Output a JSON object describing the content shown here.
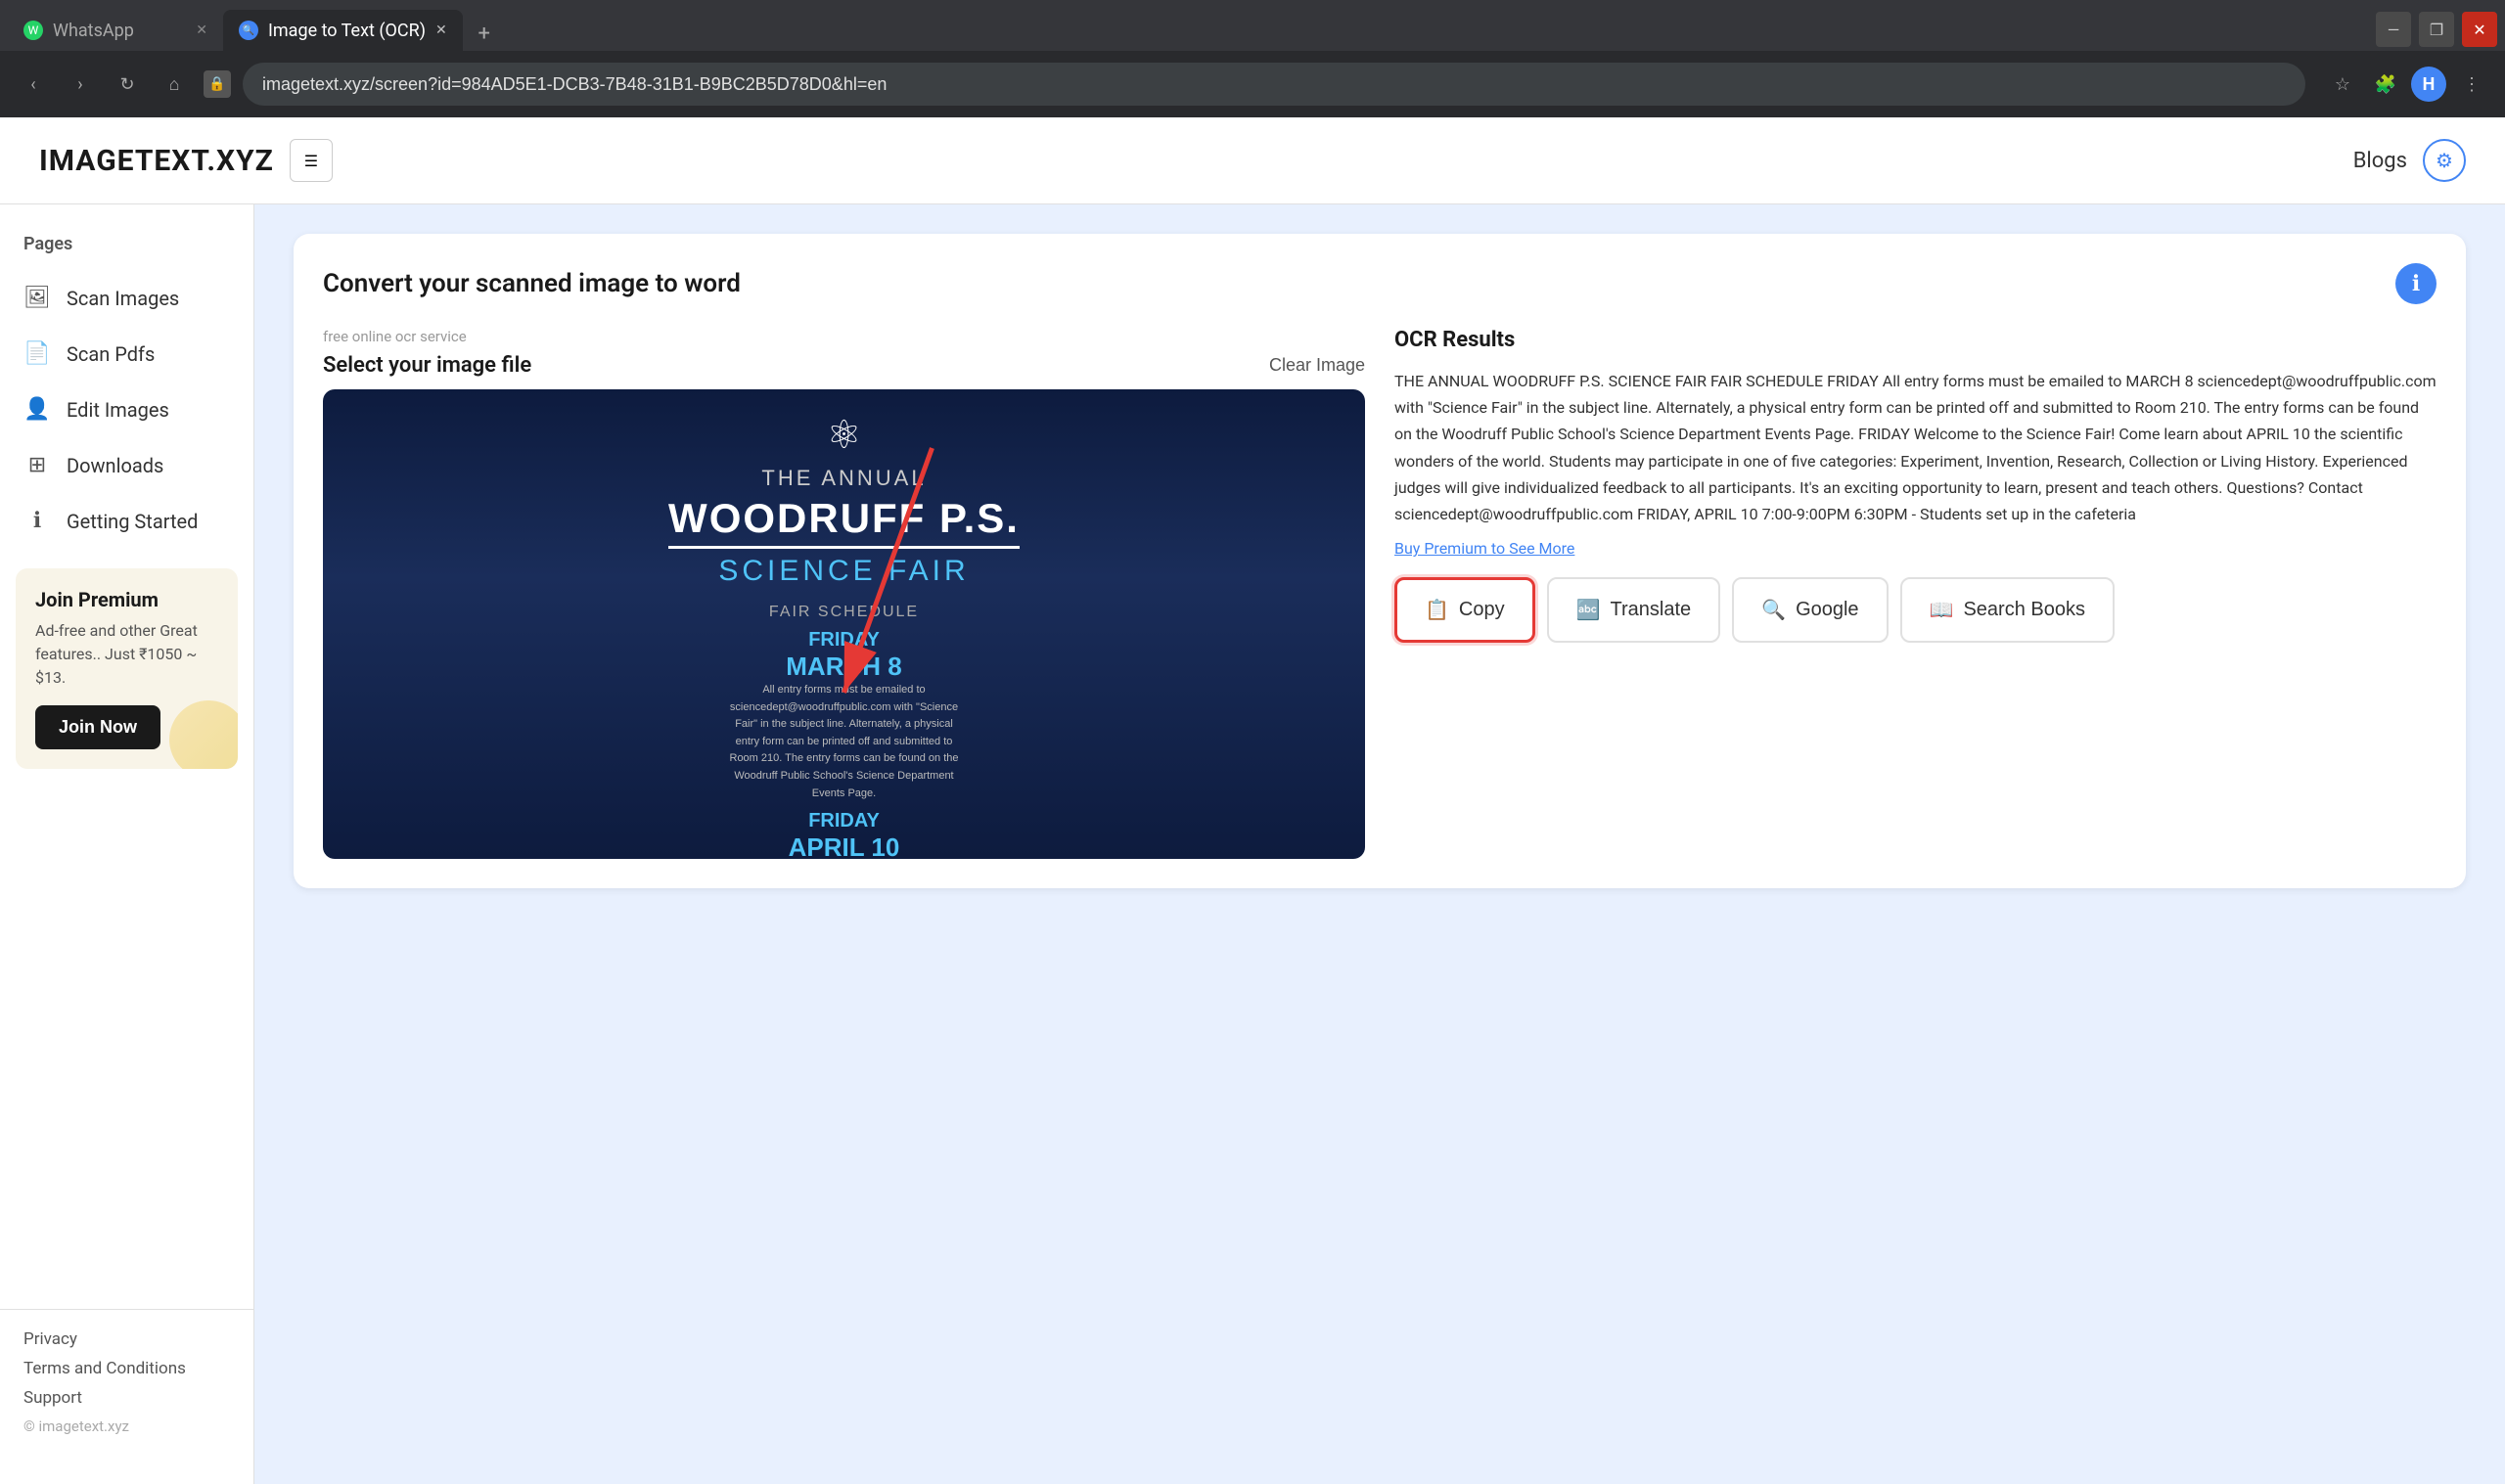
{
  "browser": {
    "tabs": [
      {
        "id": "whatsapp",
        "label": "WhatsApp",
        "favicon_type": "whatsapp",
        "active": false
      },
      {
        "id": "ocr",
        "label": "Image to Text (OCR)",
        "favicon_type": "ocr",
        "active": true
      }
    ],
    "new_tab_label": "+",
    "address_bar": "imagetext.xyz/screen?id=984AD5E1-DCB3-7B48-31B1-B9BC2B5D78D0&hl=en",
    "window_controls": {
      "minimize": "—",
      "maximize": "❐",
      "close": "✕"
    }
  },
  "header": {
    "logo": "IMAGETEXT.XYZ",
    "hamburger": "☰",
    "blogs_label": "Blogs",
    "settings_icon": "⚙"
  },
  "sidebar": {
    "pages_label": "Pages",
    "items": [
      {
        "id": "scan-images",
        "label": "Scan Images",
        "icon": "🖼"
      },
      {
        "id": "scan-pdfs",
        "label": "Scan Pdfs",
        "icon": "📄"
      },
      {
        "id": "edit-images",
        "label": "Edit Images",
        "icon": "👤"
      },
      {
        "id": "downloads",
        "label": "Downloads",
        "icon": "⊞"
      },
      {
        "id": "getting-started",
        "label": "Getting Started",
        "icon": "ℹ"
      }
    ],
    "premium": {
      "title": "Join Premium",
      "description": "Ad-free and other Great features.. Just ₹1050 ~ $13.",
      "button_label": "Join Now"
    },
    "footer": {
      "links": [
        "Privacy",
        "Terms and Conditions",
        "Support"
      ],
      "copyright": "© imagetext.xyz"
    }
  },
  "main": {
    "card_title": "Convert your scanned image to word",
    "info_icon": "ℹ",
    "image_section": {
      "upload_label": "free online ocr service",
      "select_title": "Select your image file",
      "clear_button": "Clear Image"
    },
    "ocr_section": {
      "title": "OCR Results",
      "text": "THE ANNUAL WOODRUFF P.S. SCIENCE FAIR FAIR SCHEDULE FRIDAY All entry forms must be emailed to MARCH 8 sciencedept@woodruffpublic.com with \"Science Fair\" in the subject line. Alternately, a physical entry form can be printed off and submitted to Room 210. The entry forms can be found on the Woodruff Public School's Science Department Events Page. FRIDAY Welcome to the Science Fair! Come learn about APRIL 10 the scientific wonders of the world. Students may participate in one of five categories: Experiment, Invention, Research, Collection or Living History. Experienced judges will give individualized feedback to all participants. It's an exciting opportunity to learn, present and teach others. Questions? Contact sciencedept@woodruffpublic.com FRIDAY, APRIL 10 7:00-9:00PM 6:30PM - Students set up in the cafeteria",
      "buy_premium_link": "Buy Premium to See More",
      "buttons": [
        {
          "id": "copy",
          "label": "Copy",
          "icon": "📋",
          "highlighted": true
        },
        {
          "id": "translate",
          "label": "Translate",
          "icon": "🔤"
        },
        {
          "id": "google",
          "label": "Google",
          "icon": "🔍"
        },
        {
          "id": "search-books",
          "label": "Search Books",
          "icon": "📖"
        }
      ]
    }
  }
}
